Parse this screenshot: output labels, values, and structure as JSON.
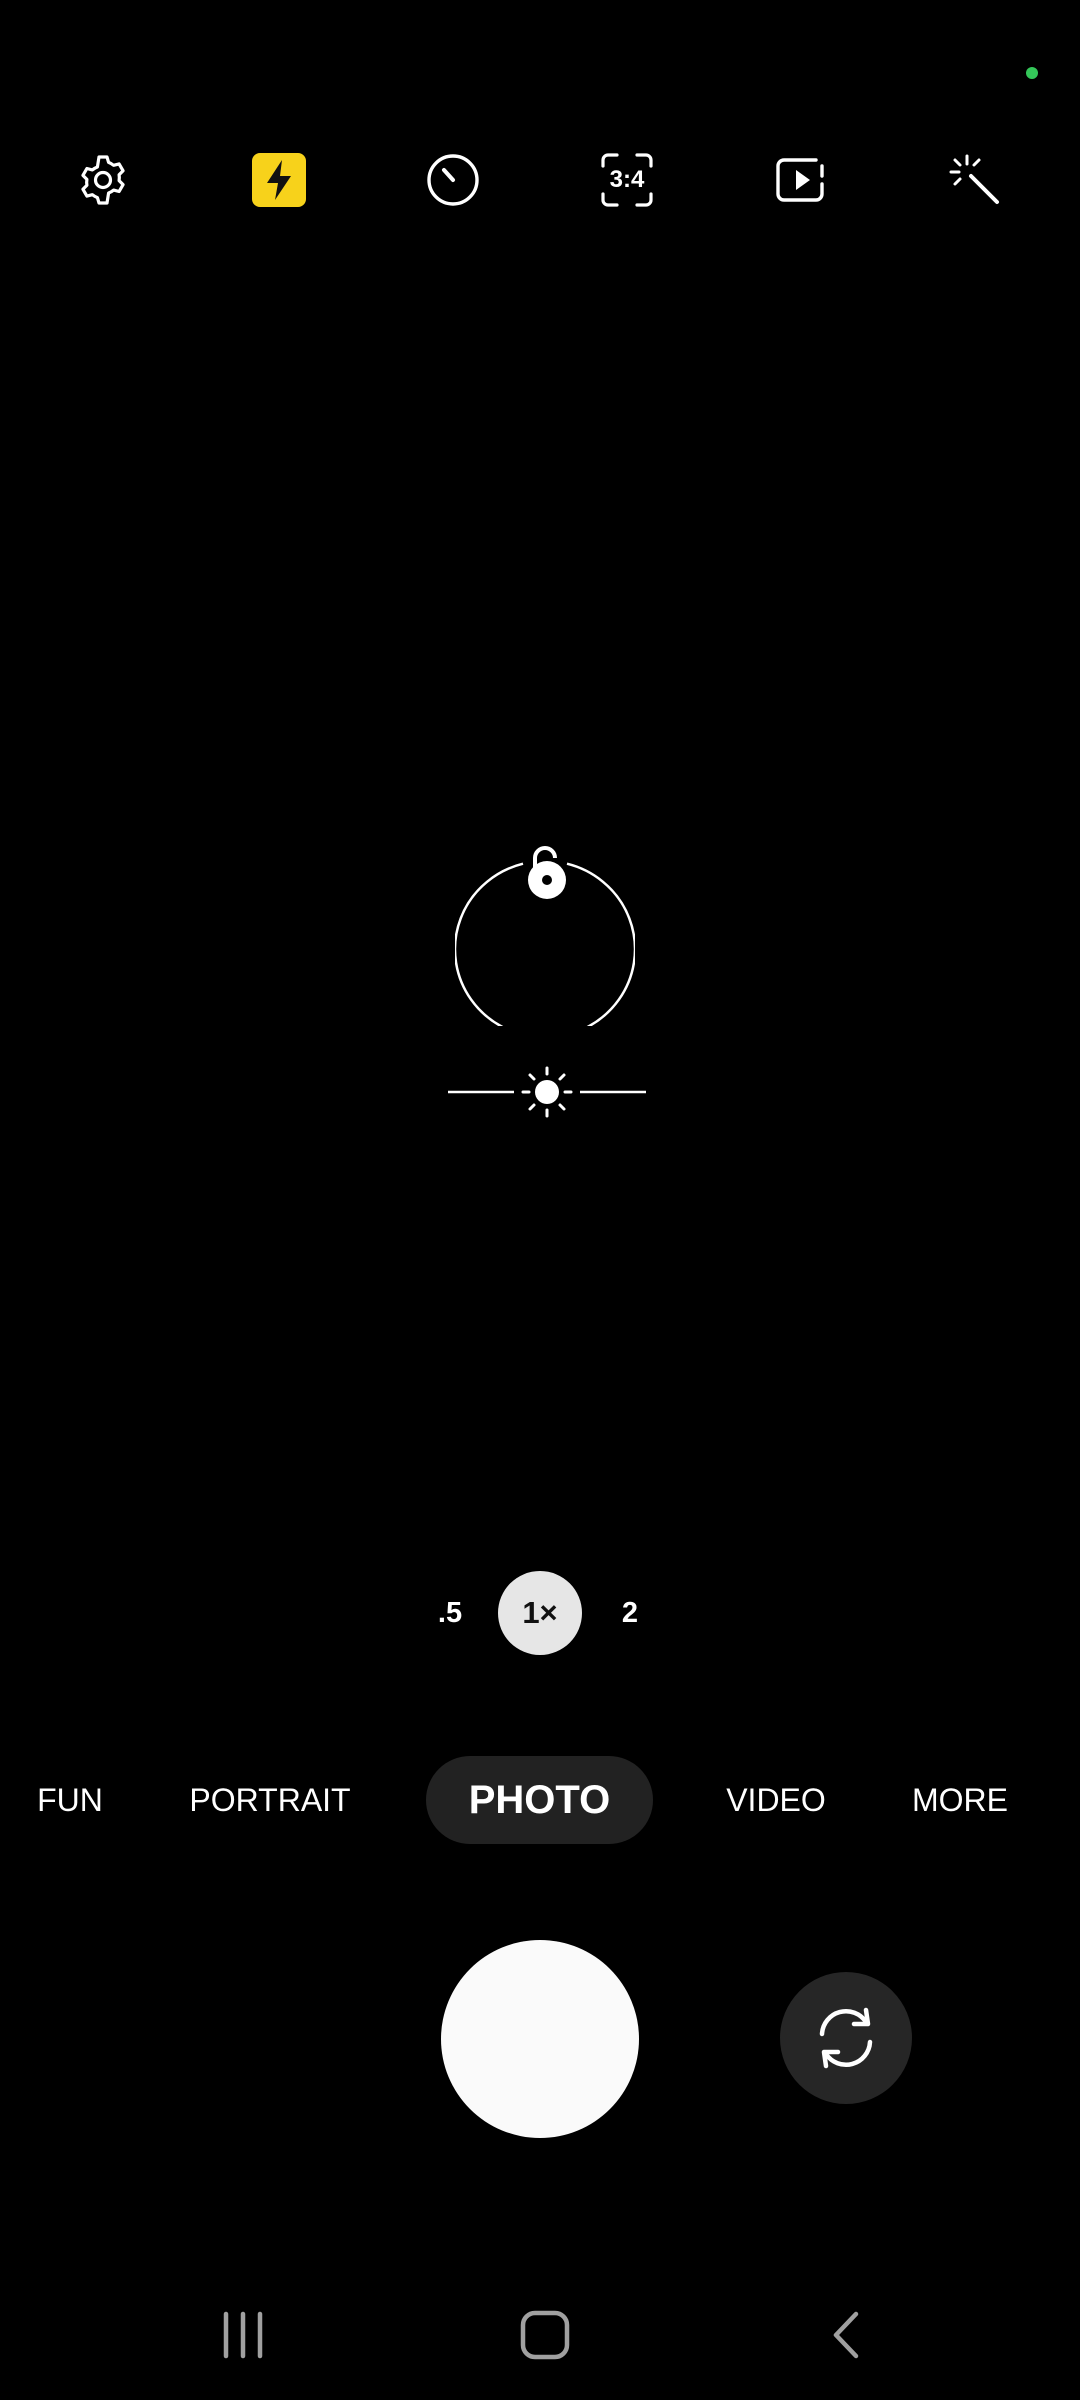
{
  "colors": {
    "background": "#000000",
    "privacy_dot": "#34c759",
    "flash_accent": "#f7d21b",
    "zoom_active_bg": "#e6e6e6",
    "mode_active_bg": "#222222",
    "shutter": "#fafafa",
    "switch_bg": "#262626",
    "nav_icon": "#a0a0a0"
  },
  "toolbar": {
    "icons": [
      "settings-icon",
      "flash-icon",
      "timer-icon",
      "aspect-ratio-icon",
      "motion-photo-icon",
      "filter-wand-icon"
    ],
    "aspect_ratio_label": "3:4"
  },
  "focus": {
    "icons": [
      "focus-ring",
      "unlock-icon",
      "brightness-icon"
    ]
  },
  "zoom": {
    "options": [
      {
        "label": ".5",
        "active": false
      },
      {
        "label": "1×",
        "active": true
      },
      {
        "label": "2",
        "active": false
      }
    ]
  },
  "modes": {
    "items": [
      {
        "label": "FUN",
        "active": false
      },
      {
        "label": "PORTRAIT",
        "active": false
      },
      {
        "label": "PHOTO",
        "active": true
      },
      {
        "label": "VIDEO",
        "active": false
      },
      {
        "label": "MORE",
        "active": false
      }
    ]
  },
  "controls": {
    "icons": [
      "shutter-button",
      "switch-camera-icon"
    ]
  },
  "navbar": {
    "icons": [
      "recents-icon",
      "home-icon",
      "back-icon"
    ]
  }
}
